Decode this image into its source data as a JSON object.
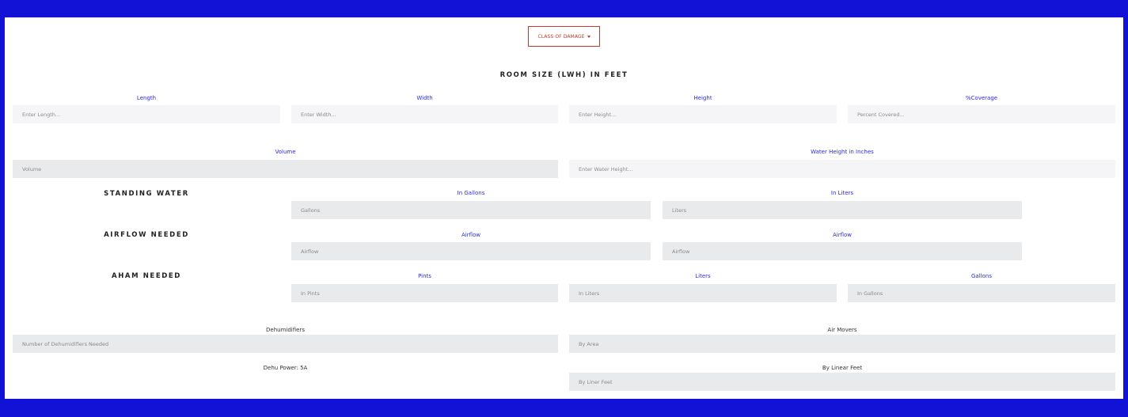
{
  "class_dropdown": {
    "label": "CLASS OF DAMAGE"
  },
  "room_size": {
    "heading": "ROOM SIZE (LWH) IN FEET"
  },
  "dimensions": {
    "length": {
      "label": "Length",
      "placeholder": "Enter Length..."
    },
    "width": {
      "label": "Width",
      "placeholder": "Enter Width..."
    },
    "height": {
      "label": "Height",
      "placeholder": "Enter Height..."
    },
    "coverage": {
      "label": "%Coverage",
      "placeholder": "Percent Covered..."
    }
  },
  "volume": {
    "label": "Volume",
    "placeholder": "Volume"
  },
  "water_height": {
    "label": "Water Height in Inches",
    "placeholder": "Enter Water Height..."
  },
  "standing_water": {
    "heading": "STANDING WATER",
    "gallons": {
      "label": "In Gallons",
      "placeholder": "Gallons"
    },
    "liters": {
      "label": "In Liters",
      "placeholder": "Liters"
    }
  },
  "airflow_needed": {
    "heading": "AIRFLOW NEEDED",
    "left": {
      "label": "Airflow",
      "placeholder": "Airflow"
    },
    "right": {
      "label": "Airflow",
      "placeholder": "Airflow"
    }
  },
  "aham_needed": {
    "heading": "AHAM NEEDED",
    "pints": {
      "label": "Pints",
      "placeholder": "In Pints"
    },
    "liters": {
      "label": "Liters",
      "placeholder": "In Liters"
    },
    "gallons": {
      "label": "Gallons",
      "placeholder": "In Gallons"
    }
  },
  "dehumidifiers": {
    "label": "Dehumidifiers",
    "placeholder": "Number of Dehumidifiers Needed"
  },
  "air_movers": {
    "label": "Air Movers",
    "placeholder": "By Area"
  },
  "dehu_power": {
    "text": "Dehu Power: 5A"
  },
  "linear_feet": {
    "label": "By Linear Feet",
    "placeholder": "By Liner Feet"
  }
}
